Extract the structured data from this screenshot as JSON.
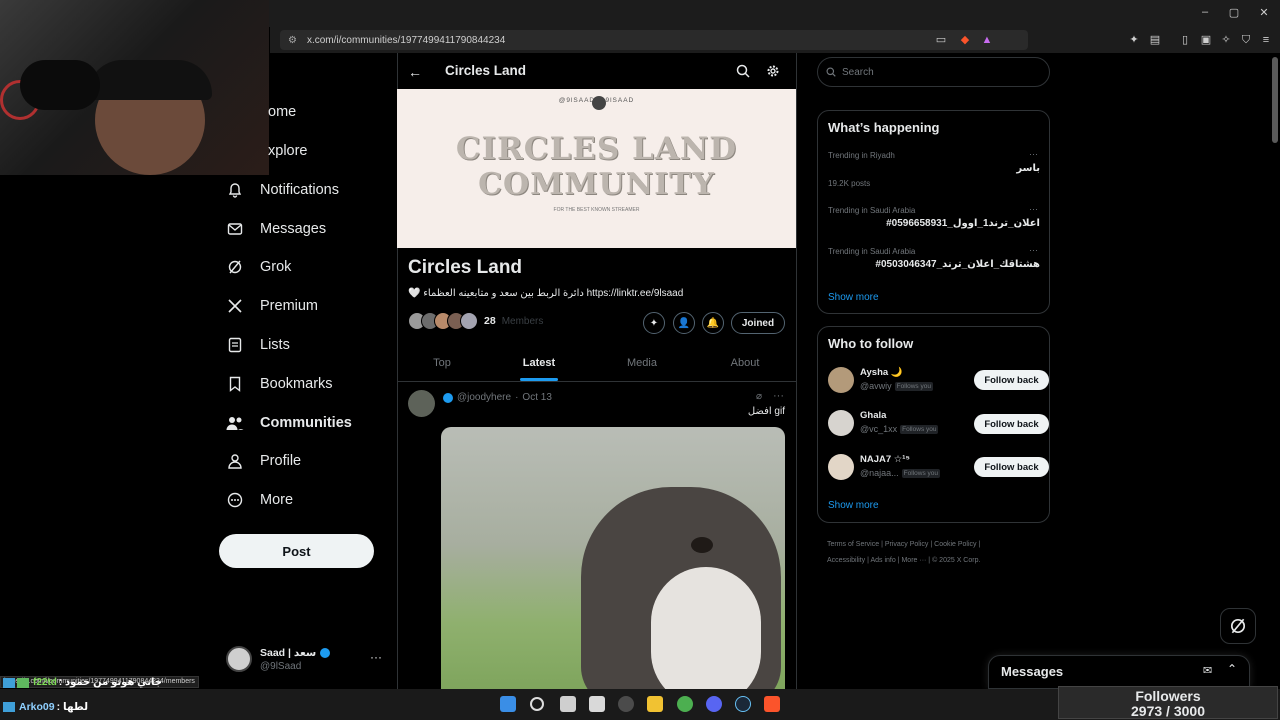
{
  "browser": {
    "url": "x.com/i/communities/1977499411790844234",
    "window_controls": [
      "–",
      "▢",
      "✕"
    ],
    "status_link": "https://x.com/i/communities/1977499411790844234/members"
  },
  "nav": {
    "items": [
      {
        "label": "Home",
        "visible": "ome",
        "icon": "home-icon"
      },
      {
        "label": "Explore",
        "visible": "xplore",
        "icon": "search-icon"
      },
      {
        "label": "Notifications",
        "icon": "bell-icon"
      },
      {
        "label": "Messages",
        "icon": "envelope-icon"
      },
      {
        "label": "Grok",
        "icon": "grok-icon"
      },
      {
        "label": "Premium",
        "icon": "x-logo-icon"
      },
      {
        "label": "Lists",
        "icon": "list-icon"
      },
      {
        "label": "Bookmarks",
        "icon": "bookmark-icon"
      },
      {
        "label": "Communities",
        "icon": "people-icon"
      },
      {
        "label": "Profile",
        "icon": "person-icon"
      },
      {
        "label": "More",
        "icon": "more-circle-icon"
      }
    ],
    "post_label": "Post",
    "account": {
      "name": "Saad | سعد",
      "handle": "@9lSaad"
    }
  },
  "community": {
    "header_title": "Circles Land",
    "banner_top": "@9lSAAD   @9lSAAD",
    "banner_line1": "CIRCLES LAND",
    "banner_line2": "COMMUNITY",
    "banner_sub": "FOR THE BEST KNOWN STREAMER",
    "title": "Circles Land",
    "description": "🤍 دائرة الربط بين سعد و متابعينه العظماء https://linktr.ee/9lsaad",
    "member_count": "28",
    "members_label": "Members",
    "joined_label": "Joined",
    "tabs": [
      "Top",
      "Latest",
      "Media",
      "About"
    ],
    "active_tab": "Latest"
  },
  "post": {
    "handle": "@joodyhere",
    "date": "Oct 13",
    "text": "افضل gif"
  },
  "sidebar": {
    "search_placeholder": "Search",
    "happening_title": "What’s happening",
    "trends": [
      {
        "meta": "Trending in Riyadh",
        "title": "باسر",
        "count": "19.2K posts"
      },
      {
        "meta": "Trending in Saudi Arabia",
        "title": "#اعلان_ترند1_اوول_0596658931",
        "count": ""
      },
      {
        "meta": "Trending in Saudi Arabia",
        "title": "#هشتاقك_اعلان_ترند_0503046347",
        "count": ""
      }
    ],
    "show_more": "Show more",
    "wtf_title": "Who to follow",
    "follows": [
      {
        "name": "Aysha 🌙",
        "handle": "@avwiy",
        "badge": "Follows you",
        "button": "Follow back"
      },
      {
        "name": "Ghala",
        "handle": "@vc_1xx",
        "badge": "Follows you",
        "button": "Follow back"
      },
      {
        "name": "NAJA7 ☆¹⁵",
        "handle": "@najaa...",
        "badge": "Follows you",
        "button": "Follow back"
      }
    ],
    "footer": [
      "Terms of Service",
      "Privacy Policy",
      "Cookie Policy",
      "Accessibility",
      "Ads info",
      "More ···",
      "© 2025 X Corp."
    ]
  },
  "messages_drawer": {
    "title": "Messages"
  },
  "overlay": {
    "chat": [
      {
        "user": "f22td",
        "text": ": جاني هونو من حمود"
      },
      {
        "user": "Arko09",
        "text": ": لطها"
      }
    ],
    "followers_label": "Followers",
    "followers_count": "2973 / 3000"
  },
  "colors": {
    "accent": "#1d9bf0",
    "bg": "#000000",
    "border": "#2f3336",
    "muted": "#71767b"
  }
}
